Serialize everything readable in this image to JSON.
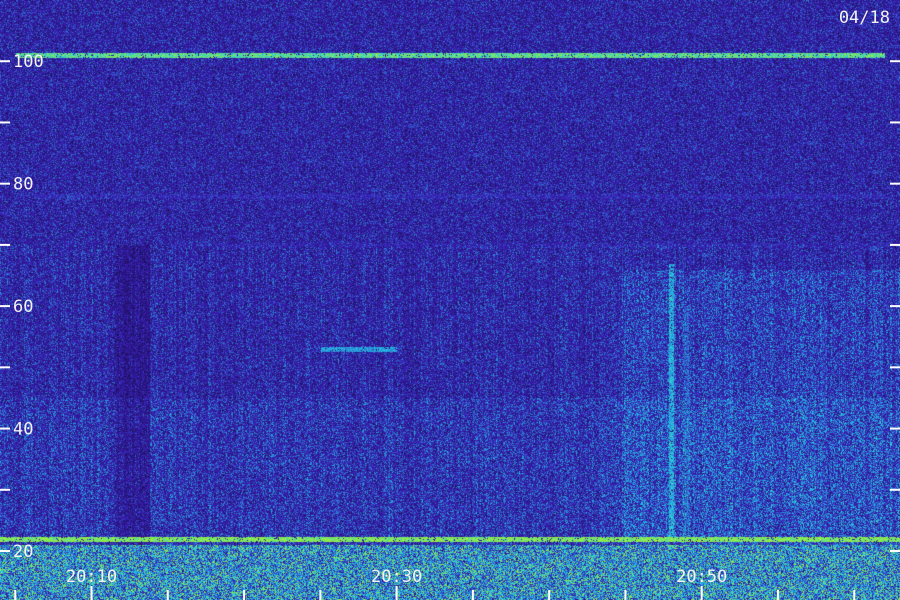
{
  "chart_data": {
    "type": "heatmap",
    "title": "",
    "xlabel": "",
    "ylabel": "",
    "date_stamp": "04/18",
    "y_axis": {
      "range": [
        12,
        110
      ],
      "major_ticks": [
        {
          "value": 20,
          "label": "20"
        },
        {
          "value": 40,
          "label": "40"
        },
        {
          "value": 60,
          "label": "60"
        },
        {
          "value": 80,
          "label": "80"
        },
        {
          "value": 100,
          "label": "100"
        }
      ],
      "minor_ticks": [
        30,
        50,
        70,
        90
      ]
    },
    "x_axis": {
      "range": [
        "20:04",
        "21:03"
      ],
      "major_ticks": [
        {
          "value": "20:10",
          "label": "20:10"
        },
        {
          "value": "20:30",
          "label": "20:30"
        },
        {
          "value": "20:50",
          "label": "20:50"
        }
      ],
      "minor_tick_interval_minutes": 5
    },
    "horizontal_bands": [
      {
        "y": 101,
        "intensity": 0.85,
        "from": "20:05",
        "to": "21:02"
      },
      {
        "y": 78,
        "intensity": 0.45,
        "from": "20:05",
        "to": "21:02"
      },
      {
        "y": 70,
        "intensity": 0.4,
        "from": "20:15",
        "to": "21:02"
      },
      {
        "y": 53,
        "intensity": 0.7,
        "from": "20:25",
        "to": "20:30"
      },
      {
        "y": 22,
        "intensity": 0.9,
        "from": "20:04",
        "to": "21:03"
      }
    ],
    "vertical_features": [
      {
        "time": "20:48",
        "y_range": [
          22,
          67
        ],
        "intensity": 0.7
      },
      {
        "time": "20:49",
        "y_range": [
          22,
          60
        ],
        "intensity": 0.55
      },
      {
        "time": "20:58",
        "y_range": [
          22,
          58
        ],
        "intensity": 0.45
      }
    ],
    "colors": {
      "low": "#120a3a",
      "mid": "#3a1fb8",
      "high": "#22c8e8",
      "peak": "#9cf03a"
    },
    "grid": false
  }
}
